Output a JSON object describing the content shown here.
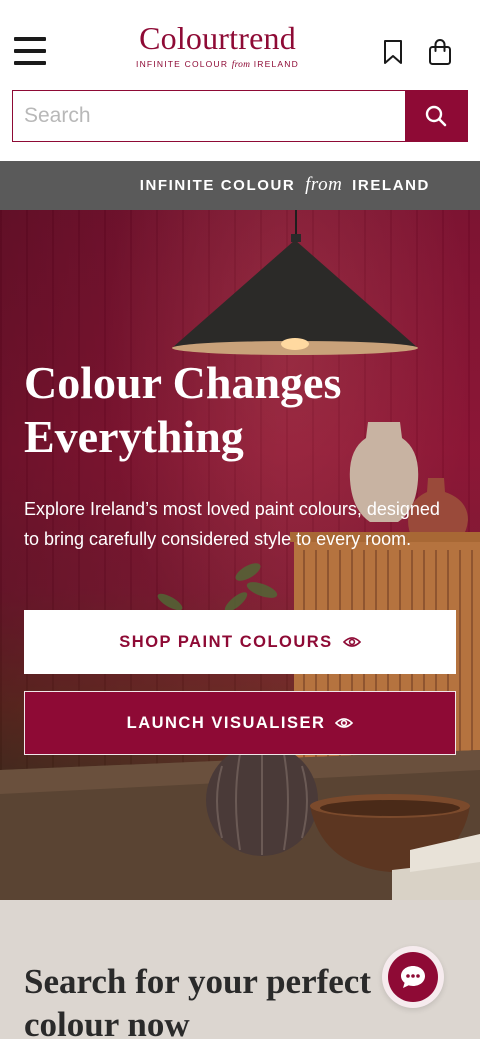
{
  "header": {
    "menu_icon": "hamburger-icon",
    "logo_text": "Colourtrend",
    "logo_tagline_start": "INFINITE COLOUR",
    "logo_tagline_from": "from",
    "logo_tagline_end": "IRELAND",
    "bookmark_icon": "bookmark-icon",
    "bag_icon": "shopping-bag-icon"
  },
  "search": {
    "placeholder": "Search",
    "value": "",
    "button_icon": "search-icon"
  },
  "banner": {
    "start": "INFINITE COLOUR",
    "from": "from",
    "end": "IRELAND"
  },
  "hero": {
    "title": "Colour Changes Everything",
    "description": "Explore Ireland’s most loved paint colours, designed to bring carefully considered style to every room.",
    "primary_button": "SHOP PAINT COLOURS",
    "secondary_button": "LAUNCH VISUALISER",
    "button_icon": "eye-icon"
  },
  "section": {
    "title": "Search for your perfect colour now"
  },
  "chat": {
    "icon": "chat-icon"
  },
  "colors": {
    "brand": "#8e0a35",
    "banner_bg": "#5a5a5a",
    "section_bg": "#dcd6d0"
  }
}
